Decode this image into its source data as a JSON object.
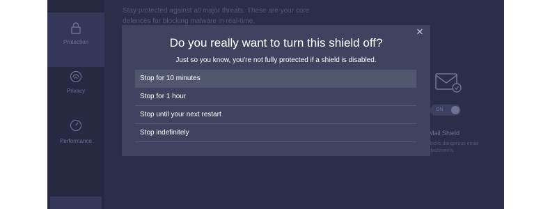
{
  "background": {
    "description": "Stay protected against all major threats. These are your core defences for blocking malware in real-time.",
    "nav": [
      {
        "label": "Protection",
        "icon": "lock-icon"
      },
      {
        "label": "Privacy",
        "icon": "fingerprint-icon"
      },
      {
        "label": "Performance",
        "icon": "speedometer-icon"
      }
    ],
    "mail_shield": {
      "title": "Mail Shield",
      "desc": "Blocks dangerous email attachments",
      "toggle": "ON"
    }
  },
  "modal": {
    "title": "Do you really want to turn this shield off?",
    "subtitle": "Just so you know, you're not fully protected if a shield is disabled.",
    "close_icon": "close-icon",
    "options": [
      "Stop for 10 minutes",
      "Stop for 1 hour",
      "Stop until your next restart",
      "Stop indefinitely"
    ]
  },
  "colors": {
    "app_bg": "#2b2e48",
    "overlay_bg": "#3f4360",
    "option_hover": "#51566f"
  }
}
